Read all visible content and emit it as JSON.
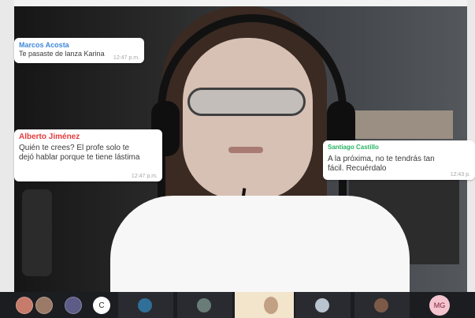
{
  "chat": {
    "messages": [
      {
        "sender": "Marcos Acosta",
        "text": "Te pasaste de lanza Karina",
        "time": "12:47 p.m."
      },
      {
        "sender": "Alberto Jiménez",
        "text": "Quién te crees? El profe solo te\ndejó hablar porque te tiene lástima",
        "time": "12:47 p.m."
      },
      {
        "sender": "Santiago Castillo",
        "text": "A la próxima, no te tendrás tan\nfácil. Recuérdalo",
        "time": "12:43 p."
      }
    ],
    "sender_colors": [
      "#3f89d8",
      "#e53b3b",
      "#28b463"
    ]
  },
  "participants": {
    "initial_c": "C",
    "initial_mg": "MG"
  },
  "colors": {
    "strip_bg": "#1c1d21",
    "mg_badge_bg": "#f4c4cf"
  }
}
